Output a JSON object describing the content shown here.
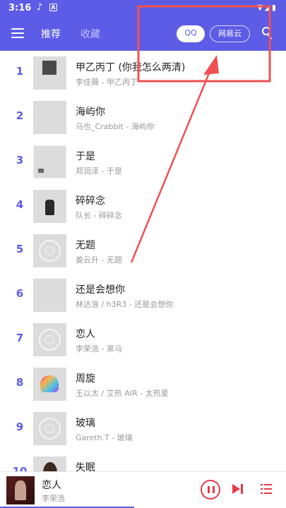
{
  "statusbar": {
    "time": "3:16",
    "note_icon": "music-note-icon",
    "a_label": "A",
    "right_icons": "▼◢▮"
  },
  "toolbar": {
    "tabs": [
      {
        "label": "推荐"
      },
      {
        "label": "收藏"
      }
    ],
    "sources": [
      {
        "label": "QQ"
      },
      {
        "label": "网易云"
      }
    ],
    "accent": "#5d5ce6"
  },
  "songs": [
    {
      "num": "1",
      "title": "甲乙丙丁 (你我怎么两清)",
      "sub": "李佳薇 - 甲乙丙丁"
    },
    {
      "num": "2",
      "title": "海屿你",
      "sub": "马也_Crabbit - 海屿你"
    },
    {
      "num": "3",
      "title": "于是",
      "sub": "郑润泽 - 于是"
    },
    {
      "num": "4",
      "title": "碎碎念",
      "sub": "队长 - 碎碎念"
    },
    {
      "num": "5",
      "title": "无题",
      "sub": "姜云升 - 无题"
    },
    {
      "num": "6",
      "title": "还是会想你",
      "sub": "林达浪 / h3R3 - 还是会想你"
    },
    {
      "num": "7",
      "title": "恋人",
      "sub": "李荣浩 - 黑马"
    },
    {
      "num": "8",
      "title": "周旋",
      "sub": "王以太 / 艾热 AIR - 太热爱"
    },
    {
      "num": "9",
      "title": "玻璃",
      "sub": "Gareth.T - 玻璃"
    },
    {
      "num": "10",
      "title": "失眠",
      "sub": ""
    }
  ],
  "player": {
    "title": "恋人",
    "artist": "李荣浩",
    "progress": 0.47,
    "accent": "#e83a4a"
  },
  "annotation": {
    "color": "#f05050"
  }
}
